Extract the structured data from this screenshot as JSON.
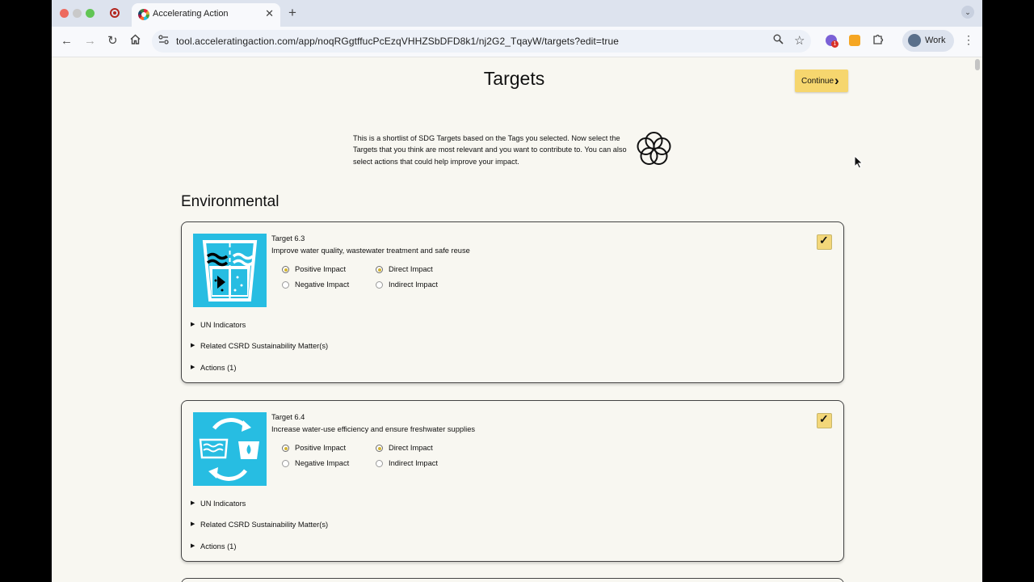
{
  "browser": {
    "tab_title": "Accelerating Action",
    "new_tab_symbol": "+",
    "tab_close_symbol": "✕",
    "url": "tool.acceleratingaction.com/app/noqRGgtffucPcEzqVHHZSbDFD8k1/nj2G2_TqayW/targets?edit=true",
    "profile_label": "Work",
    "extension_badge": "1"
  },
  "page": {
    "title": "Targets",
    "continue_label": "Continue",
    "intro_text": "This is a shortlist of SDG Targets based on the Tags you selected. Now select the Targets that you think are most relevant and you want to contribute to. You can also select actions that could help improve your impact.",
    "section_heading": "Environmental"
  },
  "colors": {
    "accent_yellow": "#f6d66e",
    "sdg6_blue": "#27bde2",
    "page_background": "#f8f7f1"
  },
  "targets": [
    {
      "number": "Target 6.3",
      "description": "Improve water quality, wastewater treatment and safe reuse",
      "icon": "water-quality-icon",
      "positive_label": "Positive Impact",
      "negative_label": "Negative Impact",
      "direct_label": "Direct Impact",
      "indirect_label": "Indirect Impact",
      "selected_impact": "Positive Impact",
      "selected_scope": "Direct Impact",
      "checked": true,
      "un_indicators_label": "UN Indicators",
      "csrd_label": "Related CSRD Sustainability Matter(s)",
      "actions_label": "Actions (1)"
    },
    {
      "number": "Target 6.4",
      "description": "Increase water-use efficiency and ensure freshwater supplies",
      "icon": "water-efficiency-icon",
      "positive_label": "Positive Impact",
      "negative_label": "Negative Impact",
      "direct_label": "Direct Impact",
      "indirect_label": "Indirect Impact",
      "selected_impact": "Positive Impact",
      "selected_scope": "Direct Impact",
      "checked": true,
      "un_indicators_label": "UN Indicators",
      "csrd_label": "Related CSRD Sustainability Matter(s)",
      "actions_label": "Actions (1)"
    }
  ]
}
